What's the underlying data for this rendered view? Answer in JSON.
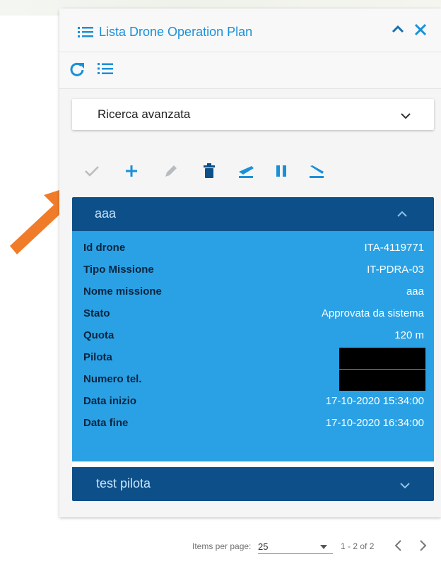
{
  "header": {
    "title": "Lista Drone Operation Plan"
  },
  "search": {
    "label": "Ricerca avanzata"
  },
  "colors": {
    "primary": "#1a90d9",
    "card_header": "#0d4f88",
    "card_body": "#2aa1e4",
    "arrow": "#f07c2a"
  },
  "icons": [
    "list-icon",
    "chevron-up-icon",
    "close-icon",
    "refresh-icon",
    "list-view-icon",
    "chevron-down-icon",
    "check-icon",
    "add-icon",
    "edit-icon",
    "delete-icon",
    "takeoff-icon",
    "pause-icon",
    "landing-icon",
    "orange-pointer-arrow"
  ],
  "cards": [
    {
      "title": "aaa",
      "expanded": true,
      "rows": [
        {
          "label": "Id drone",
          "value": "ITA-4119771"
        },
        {
          "label": "Tipo Missione",
          "value": "IT-PDRA-03"
        },
        {
          "label": "Nome missione",
          "value": "aaa"
        },
        {
          "label": "Stato",
          "value": "Approvata da sistema"
        },
        {
          "label": "Quota",
          "value": "120 m"
        },
        {
          "label": "Pilota",
          "value": ""
        },
        {
          "label": "Numero tel.",
          "value": ""
        },
        {
          "label": "Data inizio",
          "value": "17-10-2020 15:34:00"
        },
        {
          "label": "Data fine",
          "value": "17-10-2020 16:34:00"
        }
      ]
    },
    {
      "title": "test pilota",
      "expanded": false
    }
  ],
  "pager": {
    "label": "Items per page:",
    "per_page": "25",
    "range": "1 - 2 of 2"
  }
}
